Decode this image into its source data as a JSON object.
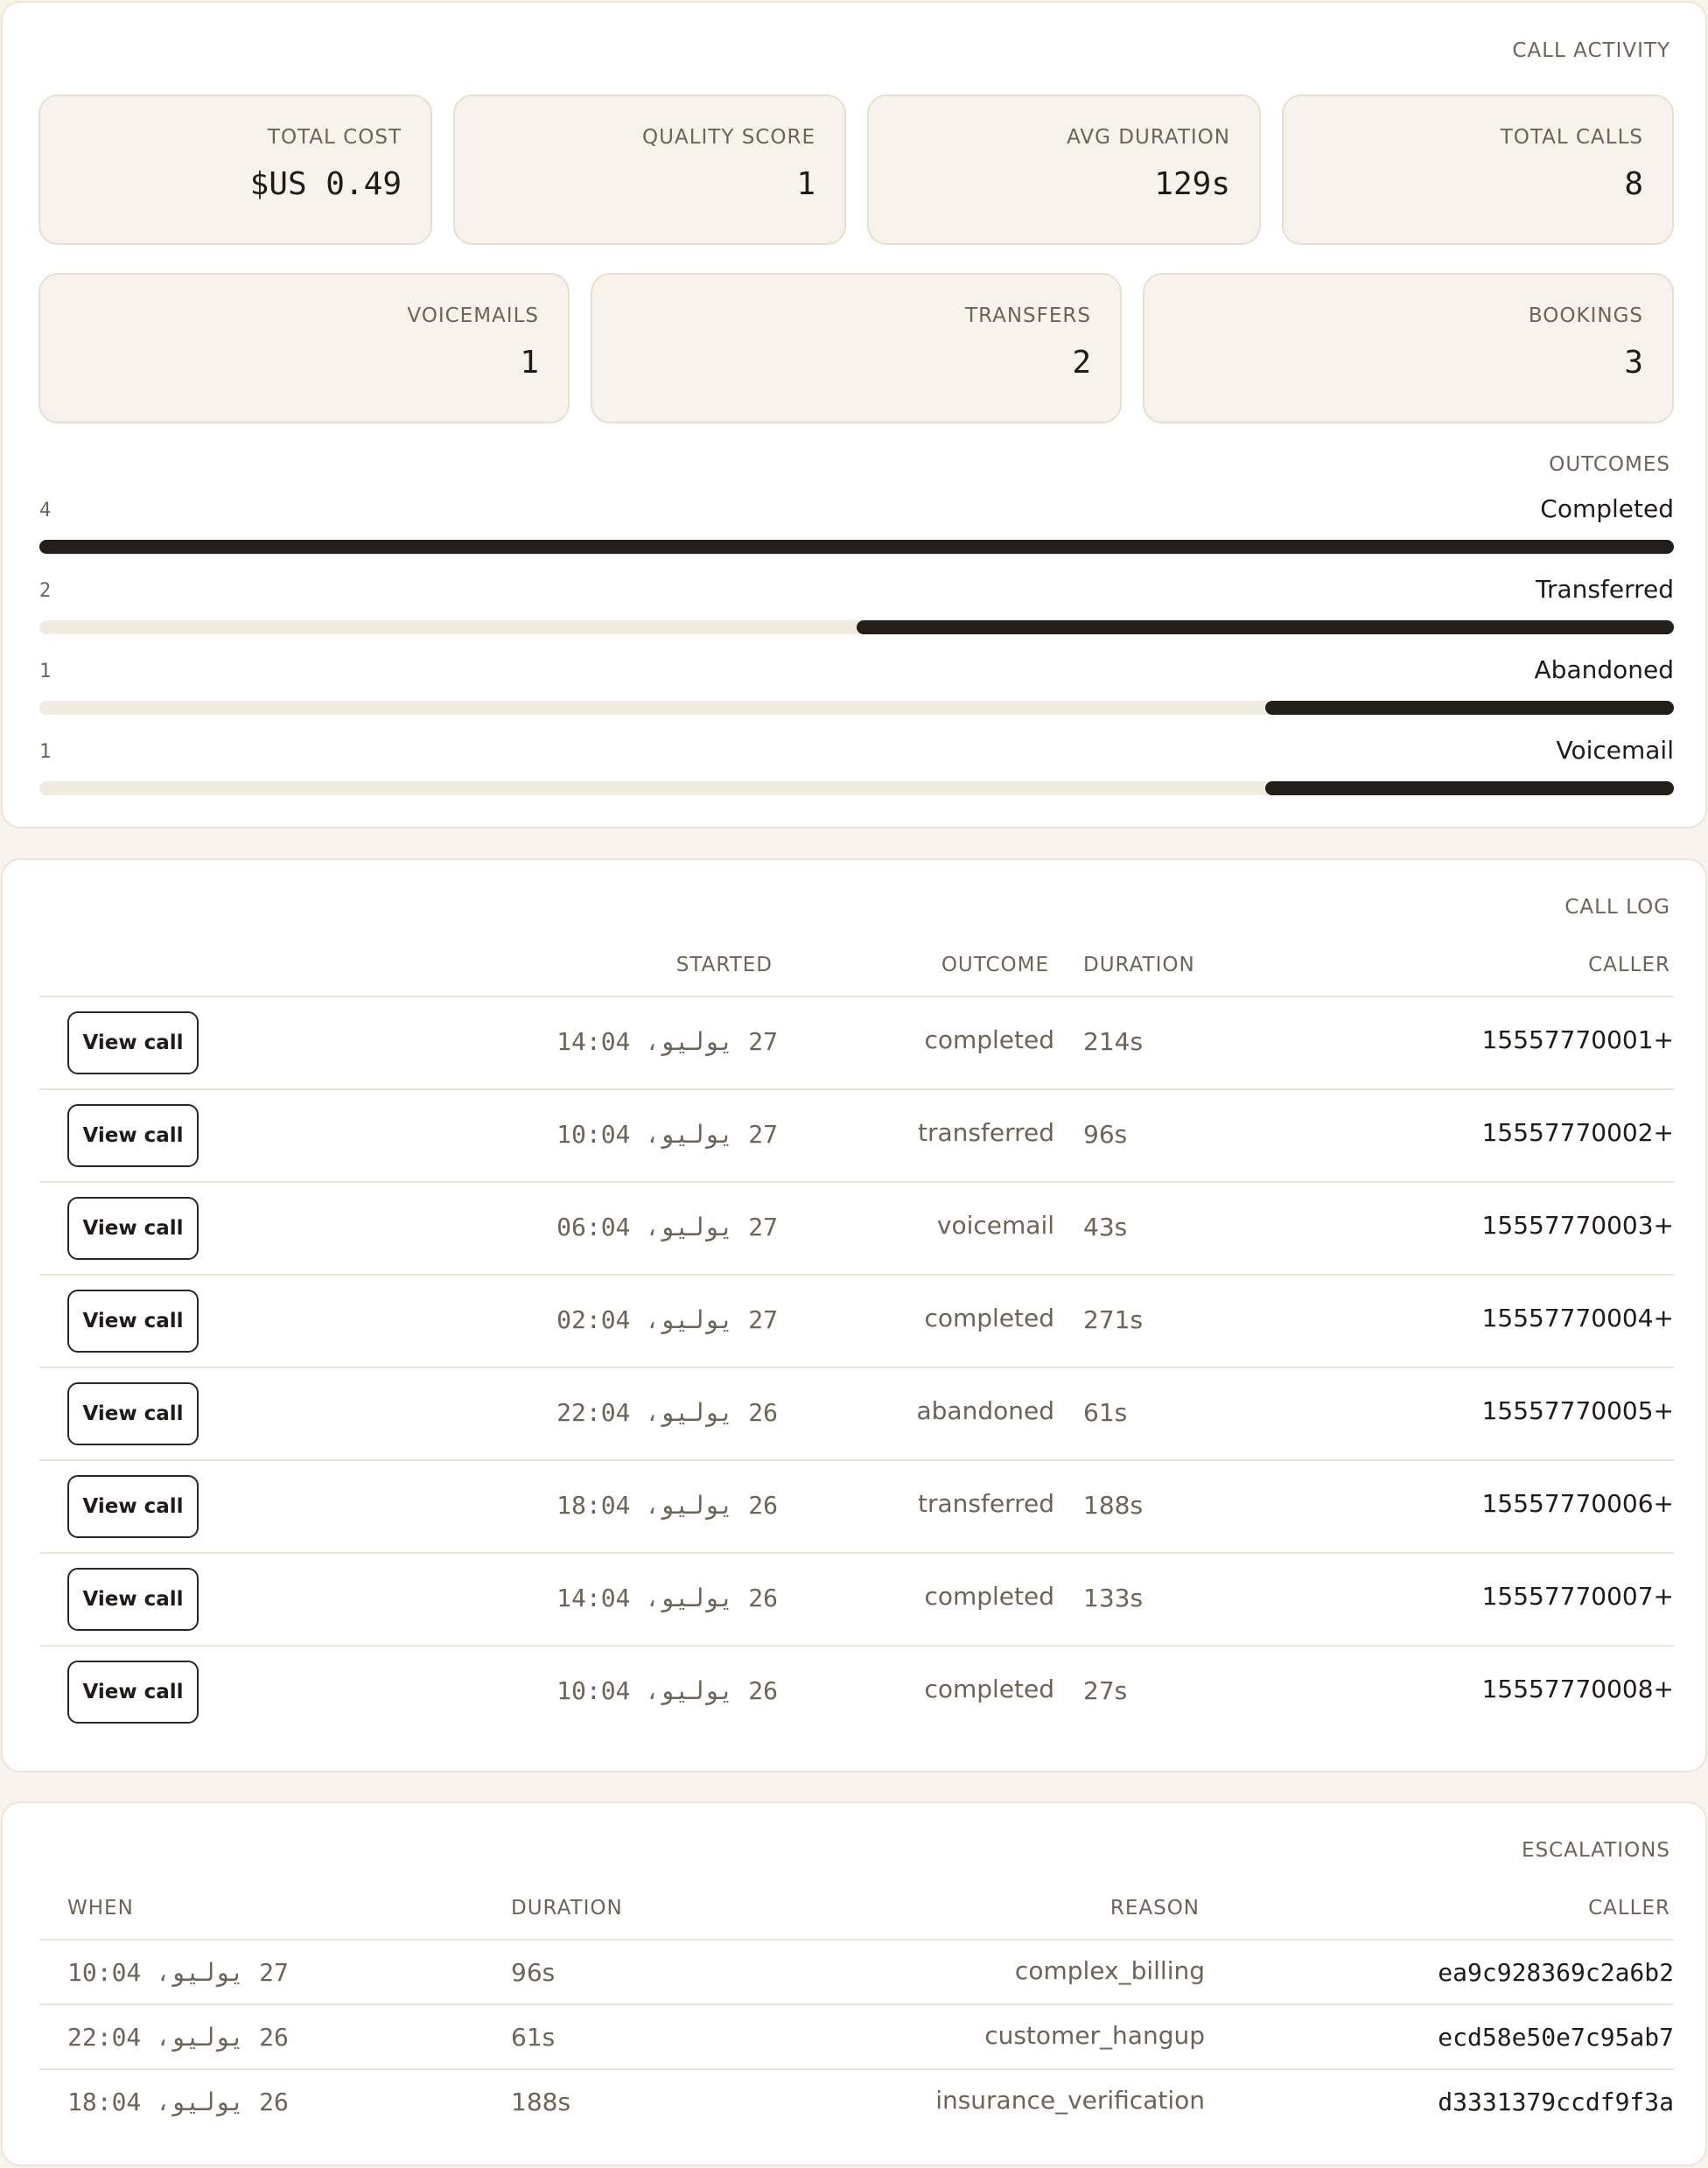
{
  "activity": {
    "title": "CALL ACTIVITY",
    "stats_row1": [
      {
        "label": "TOTAL COST",
        "value": "$US 0.49"
      },
      {
        "label": "QUALITY SCORE",
        "value": "1"
      },
      {
        "label": "AVG DURATION",
        "value": "129s"
      },
      {
        "label": "TOTAL CALLS",
        "value": "8"
      }
    ],
    "stats_row2": [
      {
        "label": "VOICEMAILS",
        "value": "1"
      },
      {
        "label": "TRANSFERS",
        "value": "2"
      },
      {
        "label": "BOOKINGS",
        "value": "3"
      }
    ],
    "outcomes_title": "OUTCOMES",
    "outcomes": [
      {
        "name": "Completed",
        "count": 4
      },
      {
        "name": "Transferred",
        "count": 2
      },
      {
        "name": "Abandoned",
        "count": 1
      },
      {
        "name": "Voicemail",
        "count": 1
      }
    ],
    "outcomes_max": 4
  },
  "call_log": {
    "title": "CALL LOG",
    "headers": {
      "started": "STARTED",
      "outcome": "OUTCOME",
      "duration": "DURATION",
      "caller": "CALLER"
    },
    "button_label": "View call",
    "rows": [
      {
        "started": "27 يوليو، 14:04",
        "outcome": "completed",
        "duration": "214s",
        "caller": "15557770001+"
      },
      {
        "started": "27 يوليو، 10:04",
        "outcome": "transferred",
        "duration": "96s",
        "caller": "15557770002+"
      },
      {
        "started": "27 يوليو، 06:04",
        "outcome": "voicemail",
        "duration": "43s",
        "caller": "15557770003+"
      },
      {
        "started": "27 يوليو، 02:04",
        "outcome": "completed",
        "duration": "271s",
        "caller": "15557770004+"
      },
      {
        "started": "26 يوليو، 22:04",
        "outcome": "abandoned",
        "duration": "61s",
        "caller": "15557770005+"
      },
      {
        "started": "26 يوليو، 18:04",
        "outcome": "transferred",
        "duration": "188s",
        "caller": "15557770006+"
      },
      {
        "started": "26 يوليو، 14:04",
        "outcome": "completed",
        "duration": "133s",
        "caller": "15557770007+"
      },
      {
        "started": "26 يوليو، 10:04",
        "outcome": "completed",
        "duration": "27s",
        "caller": "15557770008+"
      }
    ]
  },
  "escalations": {
    "title": "ESCALATIONS",
    "headers": {
      "when": "WHEN",
      "duration": "DURATION",
      "reason": "REASON",
      "caller": "CALLER"
    },
    "rows": [
      {
        "when": "27 يوليو، 10:04",
        "duration": "96s",
        "reason": "complex_billing",
        "caller": "ea9c928369c2a6b2"
      },
      {
        "when": "26 يوليو، 22:04",
        "duration": "61s",
        "reason": "customer_hangup",
        "caller": "ecd58e50e7c95ab7"
      },
      {
        "when": "26 يوليو، 18:04",
        "duration": "188s",
        "reason": "insurance_verification",
        "caller": "d3331379ccdf9f3a"
      }
    ]
  }
}
